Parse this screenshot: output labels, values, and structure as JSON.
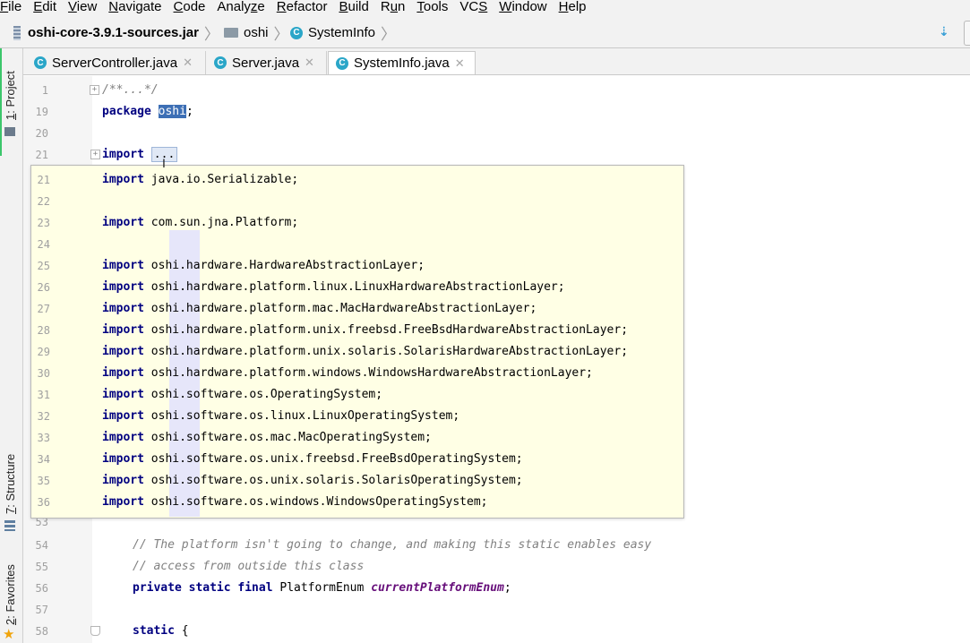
{
  "menu": {
    "items": [
      {
        "underline": "F",
        "rest": "ile"
      },
      {
        "underline": "E",
        "rest": "dit"
      },
      {
        "underline": "V",
        "rest": "iew"
      },
      {
        "underline": "N",
        "rest": "avigate"
      },
      {
        "underline": "C",
        "rest": "ode"
      },
      {
        "prefix": "Analy",
        "underline": "z",
        "rest": "e"
      },
      {
        "underline": "R",
        "rest": "efactor"
      },
      {
        "underline": "B",
        "rest": "uild"
      },
      {
        "prefix": "R",
        "underline": "u",
        "rest": "n"
      },
      {
        "underline": "T",
        "rest": "ools"
      },
      {
        "prefix": "VC",
        "underline": "S",
        "rest": ""
      },
      {
        "underline": "W",
        "rest": "indow"
      },
      {
        "underline": "H",
        "rest": "elp"
      }
    ]
  },
  "breadcrumb": {
    "jar": "oshi-core-3.9.1-sources.jar",
    "package": "oshi",
    "class": "SystemInfo",
    "class_icon": "C"
  },
  "tabs": [
    {
      "label": "ServerController.java",
      "icon": "C",
      "active": false
    },
    {
      "label": "Server.java",
      "icon": "C",
      "active": false
    },
    {
      "label": "SystemInfo.java",
      "icon": "C",
      "active": true
    }
  ],
  "tool_windows": {
    "project": {
      "num": "1",
      "label": ": Project"
    },
    "structure": {
      "num": "7",
      "label": ": Structure"
    },
    "favorites": {
      "num": "2",
      "label": ": Favorites"
    }
  },
  "editor": {
    "lines": [
      {
        "n": "1",
        "kind": "doc",
        "text": "/**...*/"
      },
      {
        "n": "19",
        "kind": "package",
        "kw": "package",
        "name": "oshi",
        "end": ";"
      },
      {
        "n": "20",
        "kind": "blank"
      },
      {
        "n": "21",
        "kind": "importfold",
        "kw": "import",
        "dots": "..."
      },
      {
        "n": "53",
        "kind": "blank"
      },
      {
        "n": "54",
        "kind": "comment",
        "text": "// The platform isn't going to change, and making this static enables easy"
      },
      {
        "n": "55",
        "kind": "comment",
        "text": "// access from outside this class"
      },
      {
        "n": "56",
        "kind": "decl",
        "kw": "private static final",
        "type": "PlatformEnum",
        "field": "currentPlatformEnum",
        "end": ";"
      },
      {
        "n": "57",
        "kind": "blank"
      },
      {
        "n": "58",
        "kind": "static",
        "kw": "static",
        "end": "{"
      }
    ]
  },
  "popup": {
    "lines": [
      {
        "n": "21",
        "pkg": "",
        "rest": "java.io.Serializable;"
      },
      {
        "n": "22"
      },
      {
        "n": "23",
        "pkg": "",
        "rest": "com.sun.jna.Platform;"
      },
      {
        "n": "24"
      },
      {
        "n": "25",
        "pkg": "oshi",
        "rest": ".hardware.HardwareAbstractionLayer;"
      },
      {
        "n": "26",
        "pkg": "oshi",
        "rest": ".hardware.platform.linux.LinuxHardwareAbstractionLayer;"
      },
      {
        "n": "27",
        "pkg": "oshi",
        "rest": ".hardware.platform.mac.MacHardwareAbstractionLayer;"
      },
      {
        "n": "28",
        "pkg": "oshi",
        "rest": ".hardware.platform.unix.freebsd.FreeBsdHardwareAbstractionLayer;"
      },
      {
        "n": "29",
        "pkg": "oshi",
        "rest": ".hardware.platform.unix.solaris.SolarisHardwareAbstractionLayer;"
      },
      {
        "n": "30",
        "pkg": "oshi",
        "rest": ".hardware.platform.windows.WindowsHardwareAbstractionLayer;"
      },
      {
        "n": "31",
        "pkg": "oshi",
        "rest": ".software.os.OperatingSystem;"
      },
      {
        "n": "32",
        "pkg": "oshi",
        "rest": ".software.os.linux.LinuxOperatingSystem;"
      },
      {
        "n": "33",
        "pkg": "oshi",
        "rest": ".software.os.mac.MacOperatingSystem;"
      },
      {
        "n": "34",
        "pkg": "oshi",
        "rest": ".software.os.unix.freebsd.FreeBsdOperatingSystem;"
      },
      {
        "n": "35",
        "pkg": "oshi",
        "rest": ".software.os.unix.solaris.SolarisOperatingSystem;"
      },
      {
        "n": "36",
        "pkg": "oshi",
        "rest": ".software.os.windows.WindowsOperatingSystem;"
      }
    ],
    "keyword": "import"
  },
  "colors": {
    "keyword": "#000080",
    "comment": "#808080",
    "field": "#660e7a",
    "selection": "#3d6fb5",
    "popup_bg": "#ffffe5",
    "class_icon": "#2aa6c8"
  }
}
